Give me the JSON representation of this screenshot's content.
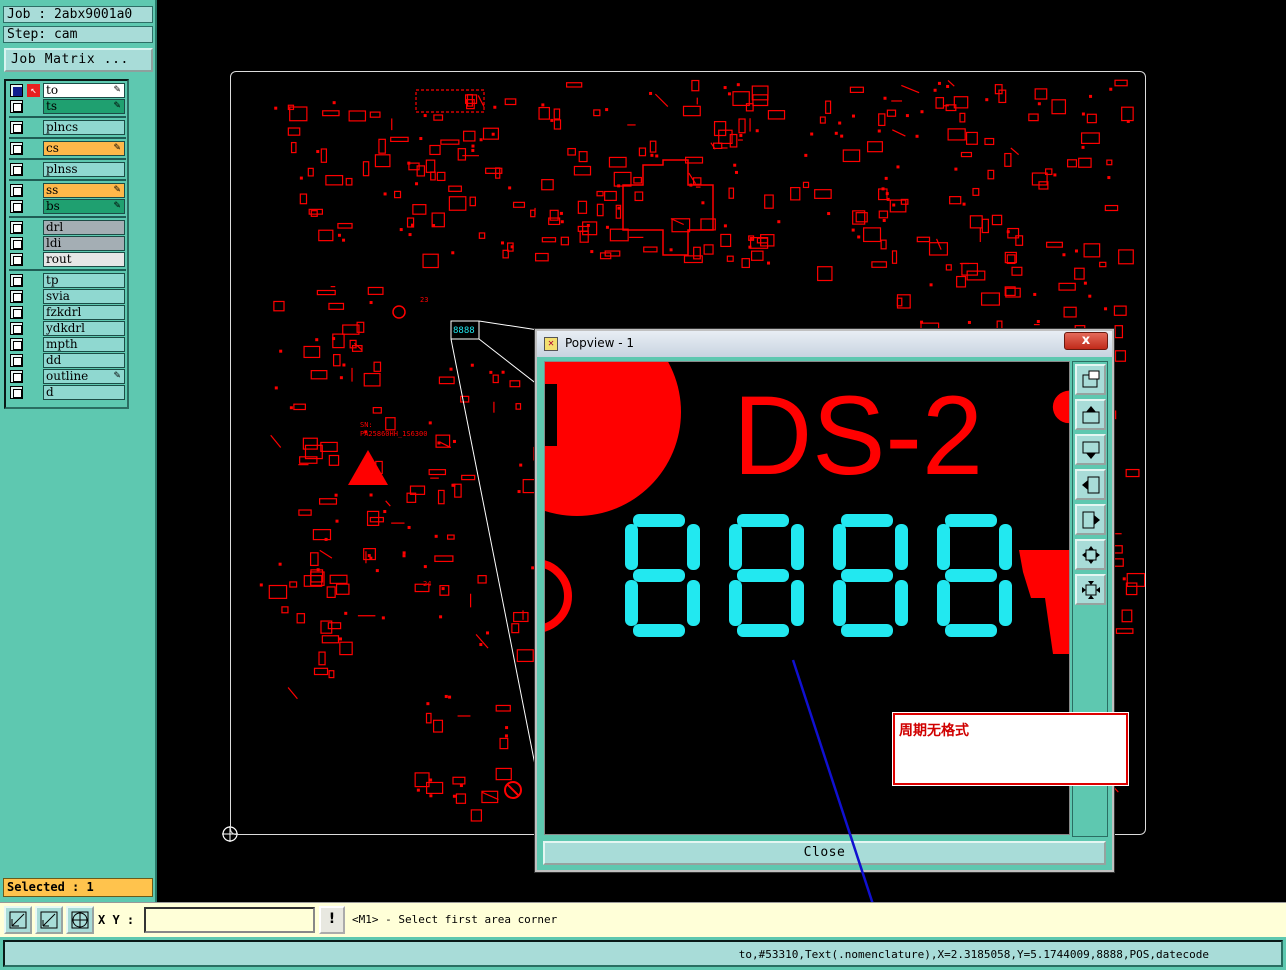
{
  "job": "Job : 2abx9001a0",
  "step": "Step: cam",
  "job_matrix_button": "Job Matrix ...",
  "layers": [
    {
      "name": "to",
      "color": "#ffffff",
      "selected": true,
      "pen": true
    },
    {
      "name": "ts",
      "color": "#1fa070",
      "selected": false,
      "pen": true
    },
    {
      "name": "plncs",
      "color": "#8fd8d0",
      "selected": false,
      "pen": false
    },
    {
      "name": "cs",
      "color": "#ffb84a",
      "selected": false,
      "pen": true
    },
    {
      "name": "plnss",
      "color": "#8fd8d0",
      "selected": false,
      "pen": false
    },
    {
      "name": "ss",
      "color": "#ffb84a",
      "selected": false,
      "pen": true
    },
    {
      "name": "bs",
      "color": "#1fa070",
      "selected": false,
      "pen": true
    },
    {
      "name": "drl",
      "color": "#a4aeb4",
      "selected": false,
      "pen": false
    },
    {
      "name": "ldi",
      "color": "#a4aeb4",
      "selected": false,
      "pen": false
    },
    {
      "name": "rout",
      "color": "#e6e6e6",
      "selected": false,
      "pen": false
    },
    {
      "name": "tp",
      "color": "#8fd8d0",
      "selected": false,
      "pen": false
    },
    {
      "name": "svia",
      "color": "#8fd8d0",
      "selected": false,
      "pen": false
    },
    {
      "name": "fzkdrl",
      "color": "#8fd8d0",
      "selected": false,
      "pen": false
    },
    {
      "name": "ydkdrl",
      "color": "#8fd8d0",
      "selected": false,
      "pen": false
    },
    {
      "name": "mpth",
      "color": "#8fd8d0",
      "selected": false,
      "pen": false
    },
    {
      "name": "dd",
      "color": "#8fd8d0",
      "selected": false,
      "pen": false
    },
    {
      "name": "outline",
      "color": "#8fd8d0",
      "selected": false,
      "pen": true
    },
    {
      "name": "d",
      "color": "#8fd8d0",
      "selected": false,
      "pen": false
    }
  ],
  "selected": "Selected : 1",
  "canvas": {
    "silk_text_1": "SN:",
    "silk_text_2": "PA25860HH_1S6300",
    "silk_text_3": "23",
    "silk_text_4": "24",
    "zoom_label": "8888"
  },
  "popview": {
    "title": "Popview - 1",
    "close_x": "x",
    "designator": "DS-2",
    "close_button": "Close"
  },
  "annotation": "周期无格式",
  "command": {
    "xy_label": "X Y :",
    "xy_value": "",
    "warn": "!",
    "message": "<M1> - Select first area corner"
  },
  "status": "to,#53310,Text(.nomenclature),X=2.3185058,Y=5.1744009,8888,POS,datecode",
  "colors": {
    "pcb_red": "#ff0000",
    "cyan": "#22e8f0",
    "panel": "#5ec8b0",
    "status": "#a8dcd8"
  }
}
